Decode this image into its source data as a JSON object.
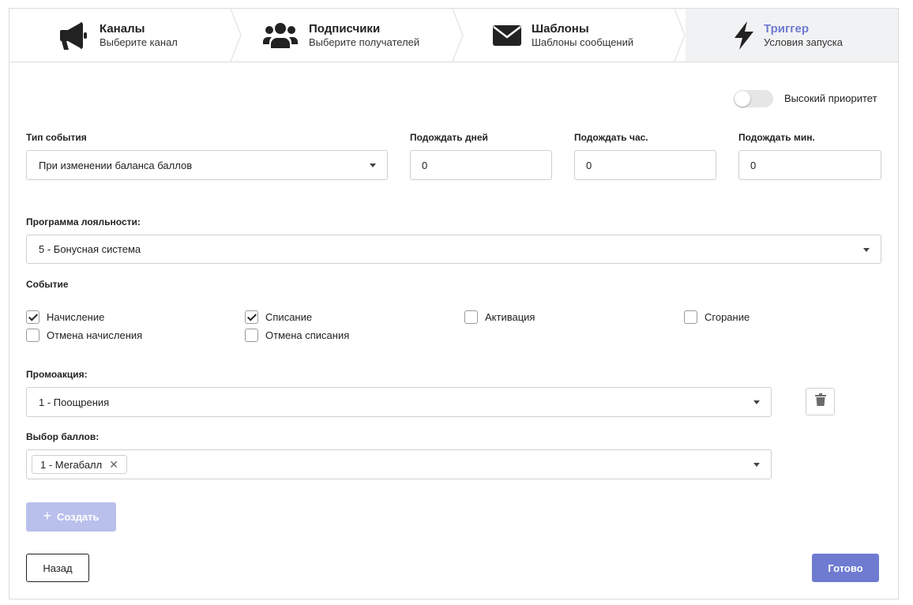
{
  "steps": [
    {
      "title": "Каналы",
      "subtitle": "Выберите канал",
      "icon": "megaphone-icon"
    },
    {
      "title": "Подписчики",
      "subtitle": "Выберите получателей",
      "icon": "users-icon"
    },
    {
      "title": "Шаблоны",
      "subtitle": "Шаблоны сообщений",
      "icon": "envelope-icon"
    },
    {
      "title": "Триггер",
      "subtitle": "Условия запуска",
      "icon": "lightning-icon"
    }
  ],
  "priority": {
    "label": "Высокий приоритет",
    "enabled": false
  },
  "event_type": {
    "label": "Тип события",
    "value": "При изменении баланса баллов"
  },
  "wait_days": {
    "label": "Подождать дней",
    "value": "0"
  },
  "wait_hours": {
    "label": "Подождать час.",
    "value": "0"
  },
  "wait_minutes": {
    "label": "Подождать мин.",
    "value": "0"
  },
  "loyalty": {
    "label": "Программа лояльности:",
    "value": "5 - Бонусная система"
  },
  "event": {
    "label": "Событие",
    "options": [
      {
        "label": "Начисление",
        "checked": true
      },
      {
        "label": "Списание",
        "checked": true
      },
      {
        "label": "Активация",
        "checked": false
      },
      {
        "label": "Сгорание",
        "checked": false
      },
      {
        "label": "Отмена начисления",
        "checked": false
      },
      {
        "label": "Отмена списания",
        "checked": false
      }
    ]
  },
  "promo": {
    "label": "Промоакция:",
    "value": "1 - Поощрения"
  },
  "points": {
    "label": "Выбор баллов:",
    "tag": "1 - Мегабалл",
    "tag_remove": "✕"
  },
  "buttons": {
    "create_plus": "+",
    "create": "Создать",
    "back": "Назад",
    "done": "Готово"
  },
  "colors": {
    "accent": "#6f7bd1",
    "accent_light": "#b9c0ec",
    "active_step_bg": "#f1f2f4"
  }
}
